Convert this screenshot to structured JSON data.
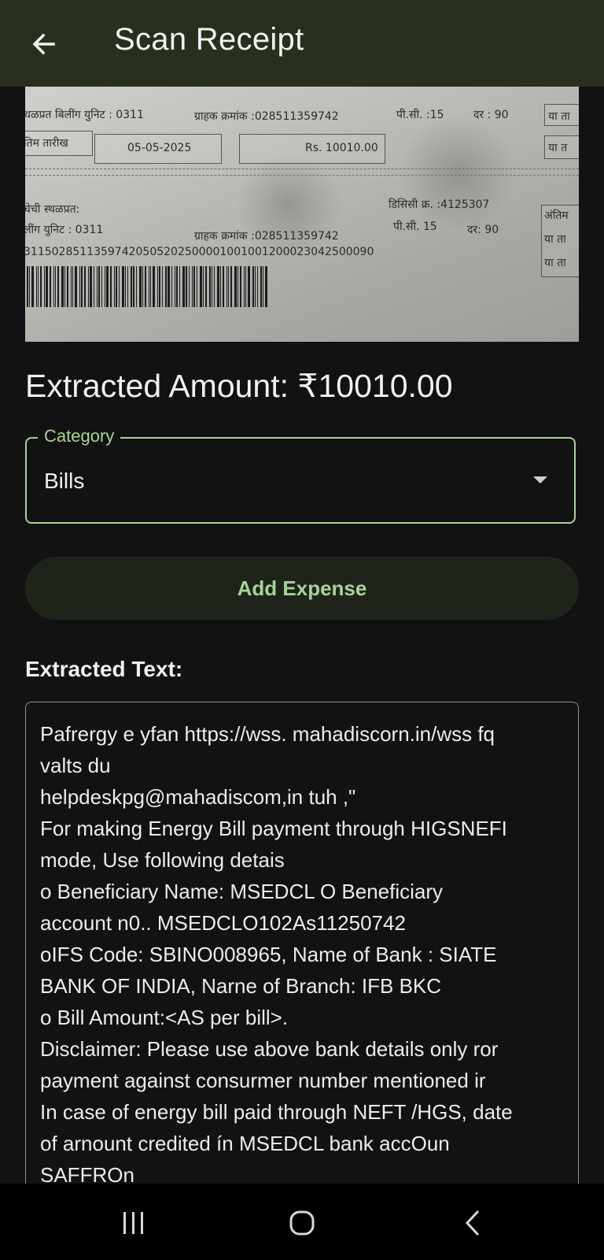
{
  "appbar": {
    "title": "Scan Receipt",
    "back_icon": "arrow-left-icon"
  },
  "receipt_image": {
    "row1_unit": "थळप्रत  बिलींग युनिट : 0311",
    "row1_consumer": "ग्राहक क्रमांक :028511359742",
    "row1_pc": "पी.सी. :15",
    "row1_rate": "दर : 90",
    "row1_side": "या ता",
    "row2_label": "तिम तारीख",
    "row2_date": "05-05-2025",
    "row2_amount": "Rs. 10010.00",
    "row2_side": "या त",
    "row3_label": "चेची स्थळप्रत:",
    "row3_ddc": "डिसिसी क्र. :4125307",
    "row4_unit": "लींग युनिट :    0311",
    "row4_consumer": "ग्राहक क्रमांक :028511359742",
    "row4_pc": "पी.सी.  15",
    "row4_rate": "दर:  90",
    "side_last": "अंतिम",
    "side_ya1": "या ता",
    "side_ya2": "या ता",
    "barcode_number": "31150285113597420505202500001001001200023042500090"
  },
  "extracted_amount": "Extracted Amount: ₹10010.00",
  "category": {
    "label": "Category",
    "selected": "Bills",
    "arrow_icon": "dropdown-arrow-icon"
  },
  "add_expense_label": "Add Expense",
  "extracted_text": {
    "heading": "Extracted Text:",
    "lines": [
      "Pafrergy e yfan https://wss. mahadiscorn.in/wss fq",
      "valts du",
      "helpdeskpg@mahadiscom,in tuh ,\"",
      "For making Energy Bill payment through HIGSNEFI",
      "mode, Use following detais",
      "o Beneficiary Name: MSEDCL O Beneficiary",
      "account n0.. MSEDCLO102As11250742",
      "oIFS Code: SBINO008965, Name of Bank : SIATE",
      "BANK OF INDIA, Narne of Branch: IFB BKC",
      "o Bill Amount:<AS per bill>.",
      "Disclaimer: Please use above bank details only ror",
      "payment against consurmer number mentioned ir",
      "In case of energy bill paid through NEFT /HGS, date",
      "of arnount credited ín MSEDCL bank accOun",
      "SAFFROn"
    ]
  },
  "navbar": {
    "recents_icon": "recents-icon",
    "home_icon": "home-icon",
    "back_icon": "nav-back-icon"
  },
  "colors": {
    "appbar_bg": "#27301f",
    "accent": "#a6d497",
    "background": "#121212"
  }
}
